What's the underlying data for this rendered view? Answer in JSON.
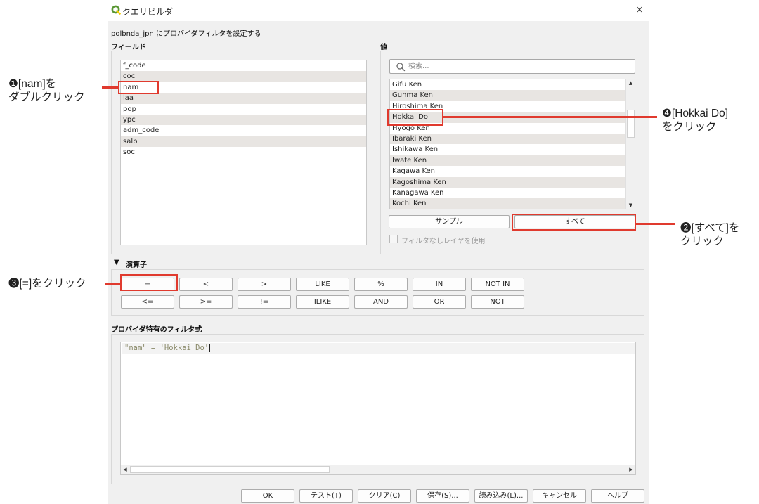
{
  "window": {
    "title": "クエリビルダ",
    "close": "×"
  },
  "dialog": {
    "description": "polbnda_jpn にプロバイダフィルタを設定する",
    "fields_label": "フィールド",
    "values_label": "値",
    "operators_label": "演算子",
    "expression_label": "プロバイダ特有のフィルタ式"
  },
  "fields": [
    "f_code",
    "coc",
    "nam",
    "laa",
    "pop",
    "ypc",
    "adm_code",
    "salb",
    "soc"
  ],
  "values_panel": {
    "search_placeholder": "検索...",
    "items": [
      "Gifu Ken",
      "Gunma Ken",
      "Hiroshima Ken",
      "Hokkai Do",
      "Hyogo Ken",
      "Ibaraki Ken",
      "Ishikawa Ken",
      "Iwate Ken",
      "Kagawa Ken",
      "Kagoshima Ken",
      "Kanagawa Ken",
      "Kochi Ken"
    ],
    "sample_button": "サンプル",
    "all_button": "すべて",
    "checkbox_label": "フィルタなしレイヤを使用",
    "checkbox_checked": false
  },
  "operators": {
    "row1": [
      "=",
      "<",
      ">",
      "LIKE",
      "%",
      "IN",
      "NOT IN"
    ],
    "row2": [
      "<=",
      ">=",
      "!=",
      "ILIKE",
      "AND",
      "OR",
      "NOT"
    ]
  },
  "expression": {
    "text": "\"nam\" = 'Hokkai Do'"
  },
  "footer_buttons": [
    "OK",
    "テスト(T)",
    "クリア(C)",
    "保存(S)...",
    "読み込み(L)...",
    "キャンセル",
    "ヘルプ"
  ],
  "annotations": {
    "step1": [
      "❶[nam]を",
      "ダブルクリック"
    ],
    "step2": [
      "❷[すべて]を",
      "クリック"
    ],
    "step3": [
      "❸[=]をクリック"
    ],
    "step4": [
      "❹[Hokkai Do]",
      "をクリック"
    ]
  },
  "colors": {
    "highlight_red": "#e03a2e",
    "app_icon_green": "#589632",
    "row_alt": "#e8e5e2",
    "dialog_bg": "#f0f0f0"
  }
}
